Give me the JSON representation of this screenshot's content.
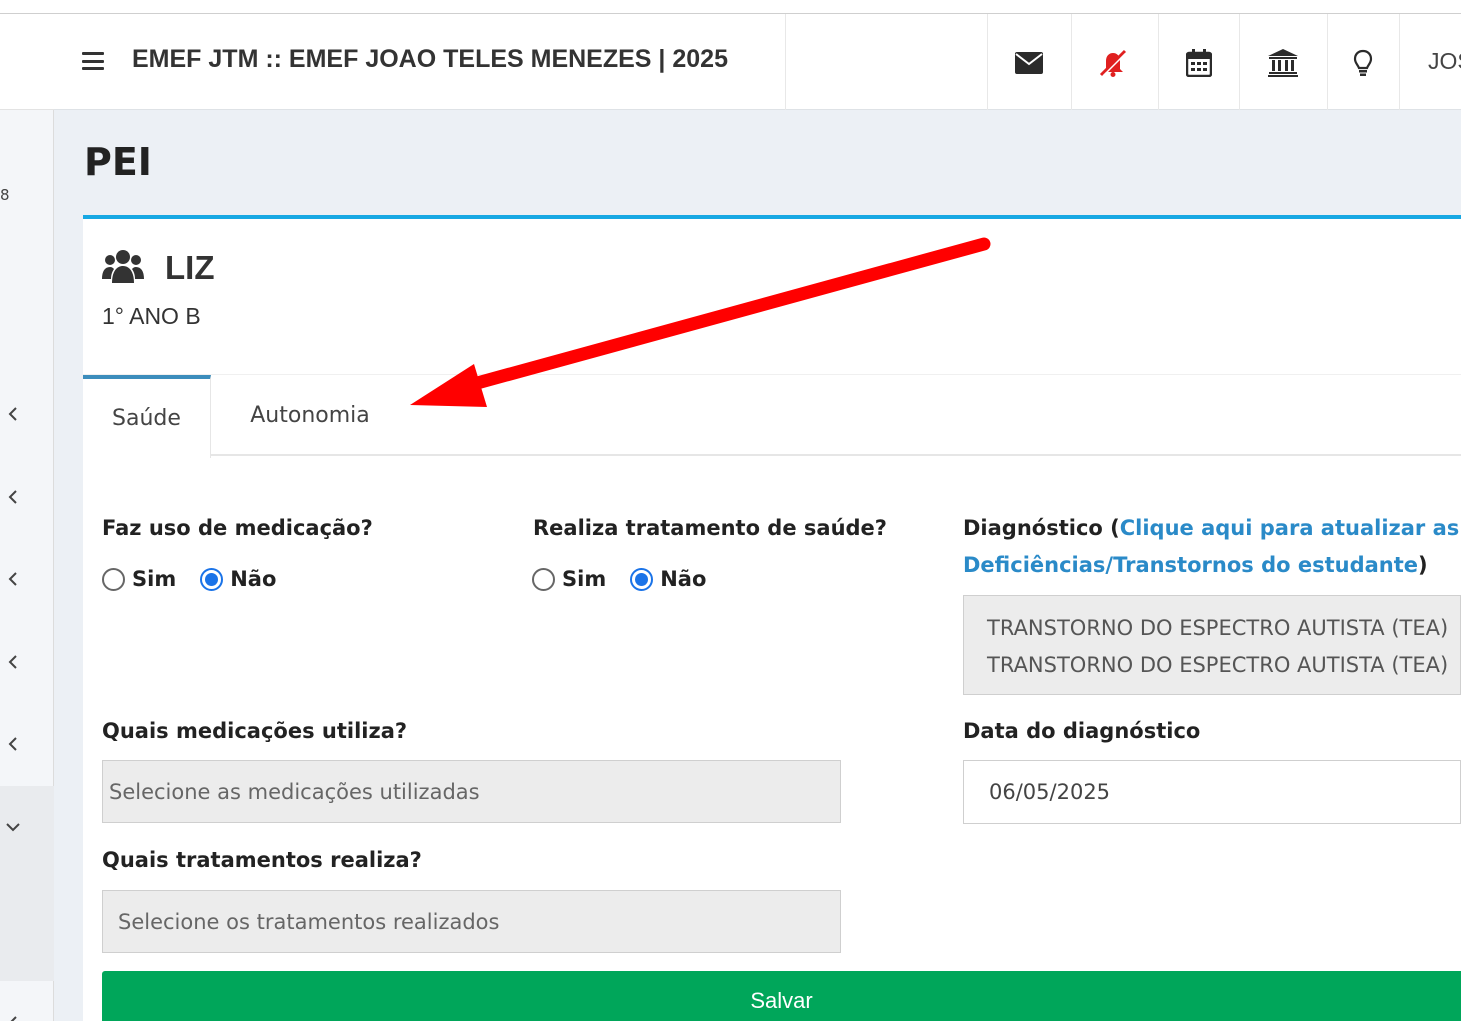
{
  "header": {
    "title": "EMEF JTM :: EMEF JOAO TELES MENEZES | 2025",
    "user_label": "JOS",
    "icons": [
      "envelope-icon",
      "bell-slash-icon",
      "calendar-icon",
      "institution-icon",
      "lightbulb-icon"
    ],
    "accent_color": "#e02020"
  },
  "sidebar": {
    "number": "8"
  },
  "page": {
    "title": "PEI"
  },
  "student": {
    "name": "LIZ",
    "class": "1° ANO B"
  },
  "tabs": [
    {
      "label": "Saúde",
      "active": true
    },
    {
      "label": "Autonomia",
      "active": false
    }
  ],
  "form": {
    "medication_question": "Faz uso de medicação?",
    "treatment_question": "Realiza tratamento de saúde?",
    "yes_label": "Sim",
    "no_label": "Não",
    "medication_selected": "Não",
    "treatment_selected": "Não",
    "diagnosis_label": "Diagnóstico",
    "diagnosis_open_paren": " (",
    "diagnosis_link_line1": "Clique aqui para atualizar as in",
    "diagnosis_link_line2": "Deficiências/Transtornos do estudante",
    "diagnosis_close_paren": ")",
    "diagnosis_values": [
      "TRANSTORNO DO ESPECTRO AUTISTA (TEA)",
      "TRANSTORNO DO ESPECTRO AUTISTA (TEA)"
    ],
    "medications_label": "Quais medicações utiliza?",
    "medications_placeholder": "Selecione as medicações utilizadas",
    "diagnosis_date_label": "Data do diagnóstico",
    "diagnosis_date_value": "06/05/2025",
    "treatments_label": "Quais tratamentos realiza?",
    "treatments_placeholder": "Selecione os tratamentos realizados",
    "save_label": "Salvar"
  },
  "colors": {
    "card_top_border": "#17a8e3",
    "active_tab_border": "#3c8dbc",
    "radio_checked": "#1a73e8",
    "link": "#2a8ac8",
    "save_button": "#00a65a",
    "annotation_arrow": "#ff0000"
  }
}
